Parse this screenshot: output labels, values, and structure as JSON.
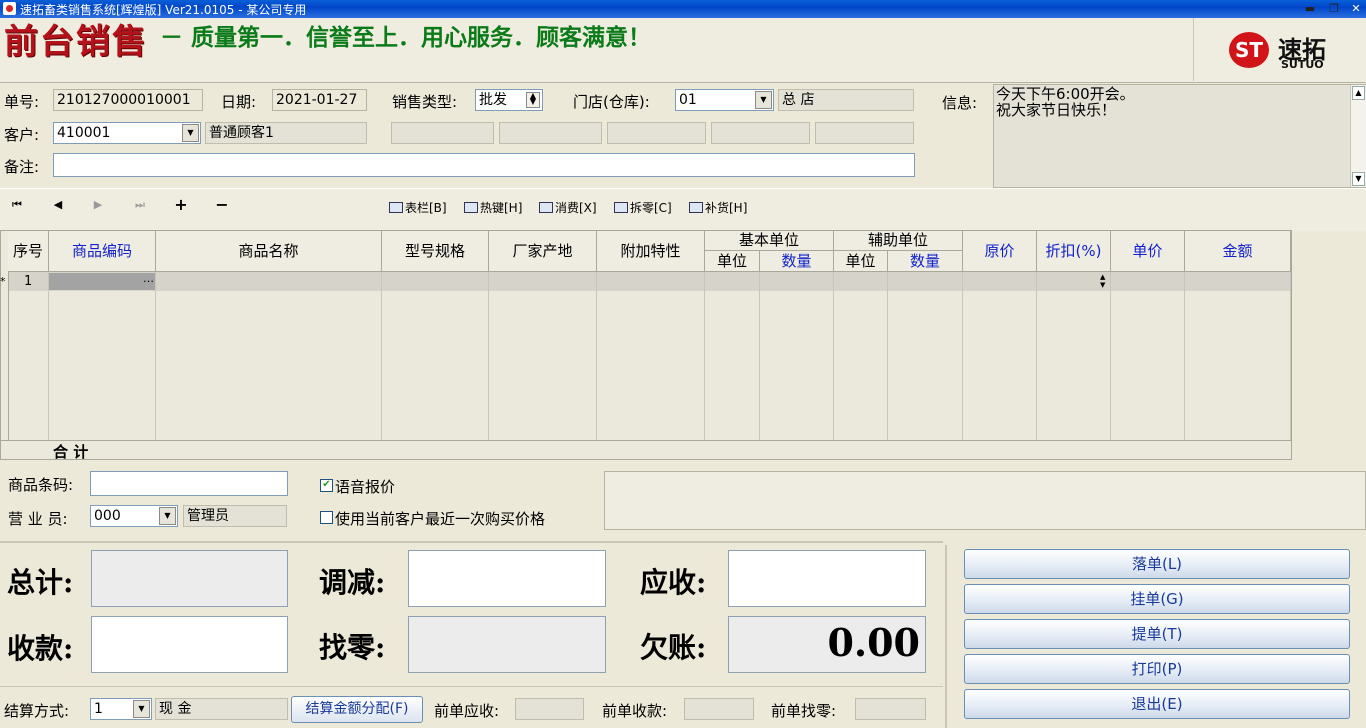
{
  "window": {
    "title": "速拓畜类销售系统[辉煌版] Ver21.0105  -  某公司专用",
    "min": "▬",
    "restore": "❐",
    "close": "✕"
  },
  "banner": {
    "title": "前台销售",
    "slogan": "－ 质量第一．信誉至上．用心服务．顾客满意！",
    "logo_mark": "ST",
    "logo_cn": "速拓",
    "logo_en": "SUTUO"
  },
  "form": {
    "order_no_label": "单号:",
    "order_no": "210127000010001",
    "date_label": "日期:",
    "date": "2021-01-27",
    "sale_type_label": "销售类型:",
    "sale_type": "批发",
    "store_label": "门店(仓库):",
    "store_code": "01",
    "store_name": "总  店",
    "customer_label": "客户:",
    "customer_code": "410001",
    "customer_name": "普通顾客1",
    "remark_label": "备注:",
    "remark": ""
  },
  "info": {
    "label": "信息:",
    "text": "今天下午6:00开会。\n祝大家节日快乐！"
  },
  "toolbar": {
    "nav_first": "⏮",
    "nav_prev": "◀",
    "nav_next": "▶",
    "nav_last": "⏭",
    "add": "+",
    "remove": "−",
    "columns_btn": "表栏[B]",
    "hotkey_btn": "热键[H]",
    "consume_btn": "消费[X]",
    "split_btn": "拆零[C]",
    "restock_btn": "补货[H]"
  },
  "grid": {
    "headers": {
      "seq": "序号",
      "code": "商品编码",
      "name": "商品名称",
      "spec": "型号规格",
      "maker": "厂家产地",
      "extra": "附加特性",
      "base_unit_group": "基本单位",
      "base_unit": "单位",
      "base_qty": "数量",
      "aux_unit_group": "辅助单位",
      "aux_unit": "单位",
      "aux_qty": "数量",
      "orig_price": "原价",
      "discount": "折扣(%)",
      "unit_price": "单价",
      "amount": "金额"
    },
    "row_marker": "*",
    "row_seq": "1",
    "ellipsis": "…",
    "total_label": "合  计"
  },
  "lower": {
    "barcode_label": "商品条码:",
    "barcode": "",
    "clerk_label": "营 业 员:",
    "clerk_code": "000",
    "clerk_name": "管理员",
    "voice_price_label": "语音报价",
    "voice_price_checked": true,
    "last_price_label": "使用当前客户最近一次购买价格",
    "last_price_checked": false
  },
  "totals": {
    "total_label": "总计:",
    "adjust_label": "调减:",
    "receivable_label": "应收:",
    "paid_label": "收款:",
    "change_label": "找零:",
    "debt_label": "欠账:",
    "debt_value": "0.00"
  },
  "actions": {
    "confirm": "落单(L)",
    "hold": "挂单(G)",
    "retrieve": "提单(T)",
    "print": "打印(P)",
    "exit": "退出(E)"
  },
  "footer": {
    "payment_label": "结算方式:",
    "payment_code": "1",
    "payment_name": "现  金",
    "split_btn": "结算金额分配(F)",
    "prev_receivable_label": "前单应收:",
    "prev_paid_label": "前单收款:",
    "prev_change_label": "前单找零:"
  }
}
